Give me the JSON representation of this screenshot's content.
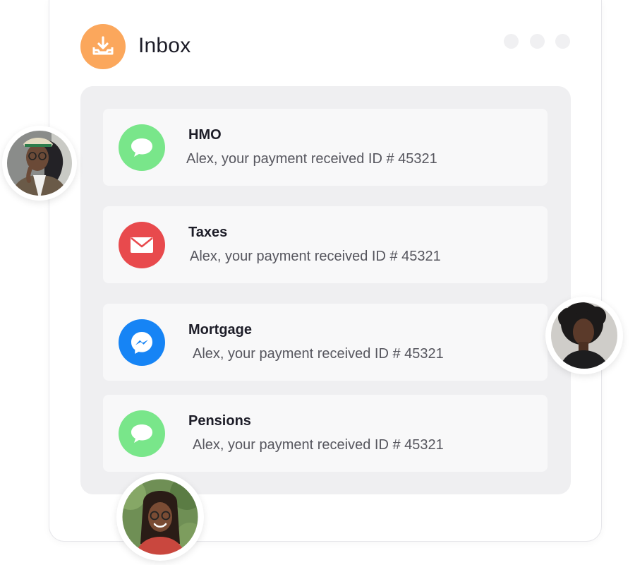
{
  "header": {
    "title": "Inbox",
    "icon": "inbox-download-icon",
    "accent_color": "#fba75c"
  },
  "messages": [
    {
      "title": "HMO",
      "text": "Alex, your payment received ID # 45321",
      "icon": "chat-bubble-icon",
      "color": "#79e68a"
    },
    {
      "title": "Taxes",
      "text": "Alex, your payment received ID # 45321",
      "icon": "mail-envelope-icon",
      "color": "#e84a4d"
    },
    {
      "title": "Mortgage",
      "text": "Alex, your payment received ID # 45321",
      "icon": "messenger-icon",
      "color": "#1684f5"
    },
    {
      "title": "Pensions",
      "text": "Alex, your payment received ID # 45321",
      "icon": "chat-bubble-icon",
      "color": "#79e68a"
    }
  ]
}
